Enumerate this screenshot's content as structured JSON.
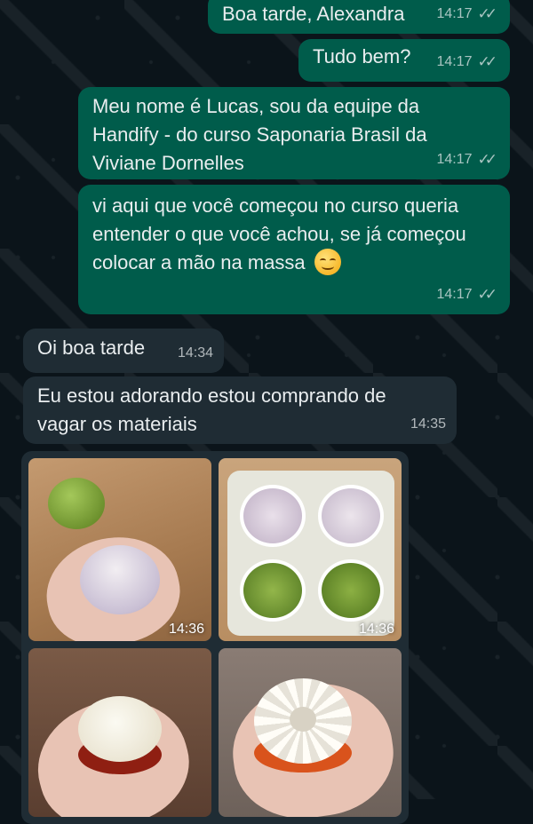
{
  "messages": [
    {
      "direction": "outgoing",
      "text": "Boa tarde, Alexandra",
      "time": "14:17",
      "status": "read"
    },
    {
      "direction": "outgoing",
      "text": "Tudo bem?",
      "time": "14:17",
      "status": "read"
    },
    {
      "direction": "outgoing",
      "text": "Meu nome é Lucas, sou da equipe da Handify - do curso Saponaria Brasil da Viviane Dornelles",
      "time": "14:17",
      "status": "read"
    },
    {
      "direction": "outgoing",
      "text": "vi aqui que você começou no curso queria entender o que você achou, se já começou colocar a mão na massa",
      "emoji": "smiling-face-with-blush",
      "time": "14:17",
      "status": "read"
    },
    {
      "direction": "incoming",
      "text": "Oi boa tarde",
      "time": "14:34"
    },
    {
      "direction": "incoming",
      "text": "Eu estou adorando estou comprando de vagar os materiais",
      "time": "14:35"
    }
  ],
  "photos": [
    {
      "subject": "hand-holding-white-soap-with-green-soap",
      "time": "14:36"
    },
    {
      "subject": "soap-mold-with-four-soaps",
      "time": "14:36"
    },
    {
      "subject": "hand-holding-white-and-red-layered-soap",
      "time": ""
    },
    {
      "subject": "hand-holding-white-bundt-soap",
      "time": ""
    }
  ],
  "colors": {
    "background": "#0b141a",
    "outgoing_bubble": "#005c4b",
    "incoming_bubble": "#1f2c34",
    "text": "#e9edef"
  },
  "icons": {
    "read_status": "double-check-icon"
  }
}
